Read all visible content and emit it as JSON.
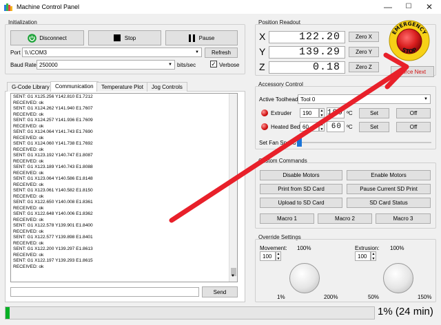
{
  "window": {
    "title": "Machine Control Panel",
    "minimize": "—",
    "maximize": "☐",
    "close": "✕"
  },
  "init": {
    "label": "Initialization",
    "disconnect": "Disconnect",
    "stop": "Stop",
    "pause": "Pause",
    "port_label": "Port",
    "port_value": "\\\\.\\COM3",
    "refresh": "Refresh",
    "baud_label": "Baud Rate",
    "baud_value": "250000",
    "baud_unit": "bits/sec",
    "verbose": "Verbose",
    "verbose_checked": true
  },
  "tabs": [
    "G-Code Library",
    "Communication",
    "Temperature Plot",
    "Jog Controls"
  ],
  "active_tab": "Communication",
  "log": [
    "SENT: G1 X125.256 Y142.810 E1.7212",
    "RECEIVED: ok",
    "SENT: G1 X124.262 Y141.940 E1.7607",
    "RECEIVED: ok",
    "SENT: G1 X124.257 Y141.936 E1.7609",
    "RECEIVED: ok",
    "SENT: G1 X124.064 Y141.743 E1.7690",
    "RECEIVED: ok",
    "SENT: G1 X124.060 Y141.738 E1.7692",
    "RECEIVED: ok",
    "SENT: G1 X123.192 Y140.747 E1.8087",
    "RECEIVED: ok",
    "SENT: G1 X123.189 Y140.743 E1.8088",
    "RECEIVED: ok",
    "SENT: G1 X123.064 Y140.586 E1.8148",
    "RECEIVED: ok",
    "SENT: G1 X123.061 Y140.582 E1.8150",
    "RECEIVED: ok",
    "SENT: G1 X122.650 Y140.008 E1.8361",
    "RECEIVED: ok",
    "SENT: G1 X122.648 Y140.006 E1.8362",
    "RECEIVED: ok",
    "SENT: G1 X122.578 Y139.901 E1.8400",
    "RECEIVED: ok",
    "SENT: G1 X122.577 Y139.898 E1.8401",
    "RECEIVED: ok",
    "SENT: G1 X122.200 Y139.297 E1.8613",
    "RECEIVED: ok",
    "SENT: G1 X122.197 Y139.293 E1.8615",
    "RECEIVED: ok"
  ],
  "send": {
    "input_value": "",
    "button": "Send"
  },
  "position": {
    "label": "Position Readout",
    "axes": [
      {
        "name": "X",
        "value": "122.20",
        "zero": "Zero X"
      },
      {
        "name": "Y",
        "value": "139.29",
        "zero": "Zero Y"
      },
      {
        "name": "Z",
        "value": "0.18",
        "zero": "Zero Z"
      }
    ]
  },
  "estop": {
    "line1": "EMERGENCY",
    "line2": "STOP",
    "force_next": "Force Next"
  },
  "accessory": {
    "label": "Accessory Control",
    "toolhead_label": "Active Toolhead",
    "toolhead_value": "Tool 0",
    "heaters": [
      {
        "name": "Extruder",
        "setpoint": "190",
        "current": "190",
        "unit": "ºC",
        "set": "Set",
        "off": "Off"
      },
      {
        "name": "Heated Bed",
        "setpoint": "60",
        "current": "60",
        "unit": "ºC",
        "set": "Set",
        "off": "Off"
      }
    ],
    "fan_label": "Set Fan Speed"
  },
  "custom": {
    "label": "Custom Commands",
    "buttons": [
      "Disable Motors",
      "Enable Motors",
      "Print from SD Card",
      "Pause Current SD Print",
      "Upload to SD Card",
      "SD Card Status"
    ],
    "macros": [
      "Macro 1",
      "Macro 2",
      "Macro 3"
    ]
  },
  "override": {
    "label": "Override Settings",
    "movement_label": "Movement:",
    "movement_pct": "100%",
    "movement_value": "100",
    "movement_min": "1%",
    "movement_max": "200%",
    "extrusion_label": "Extrusion:",
    "extrusion_pct": "100%",
    "extrusion_value": "100",
    "extrusion_min": "50%",
    "extrusion_max": "150%"
  },
  "progress": {
    "fraction": 0.01,
    "text": "1% (24 min)"
  },
  "colors": {
    "annotation_arrow": "#e8202a",
    "progress_fill": "#06b025",
    "estop_red": "#d81e1e",
    "estop_yellow": "#f7d117"
  }
}
